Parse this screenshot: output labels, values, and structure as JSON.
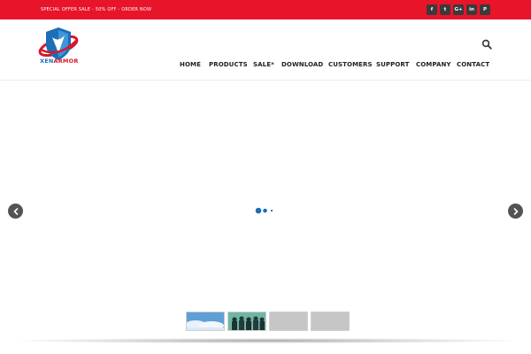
{
  "topbar": {
    "promo_text": "SPECIAL OFFER SALE - 50% OFF - ORDER NOW",
    "social": [
      {
        "label": "f",
        "icon": "facebook-icon"
      },
      {
        "label": "t",
        "icon": "twitter-icon"
      },
      {
        "label": "G+",
        "icon": "google-plus-icon"
      },
      {
        "label": "in",
        "icon": "linkedin-icon"
      },
      {
        "label": "P",
        "icon": "pinterest-icon"
      }
    ],
    "color": "#e8142a"
  },
  "brand": {
    "name_part1": "XEN",
    "name_part2": "ARMOR",
    "primary_color": "#1a6fb7",
    "accent_color": "#d8162a"
  },
  "nav": {
    "items": [
      {
        "label": "HOME"
      },
      {
        "label": "PRODUCTS"
      },
      {
        "label": "SALE*"
      },
      {
        "label": "DOWNLOAD"
      },
      {
        "label": "CUSTOMERS"
      },
      {
        "label": "SUPPORT"
      },
      {
        "label": "COMPANY"
      },
      {
        "label": "CONTACT"
      }
    ]
  },
  "slider": {
    "prev_icon": "chevron-left-icon",
    "next_icon": "chevron-right-icon",
    "loader_color": "#1a6fb7",
    "thumbnails": [
      {
        "icon": "sky-thumbnail"
      },
      {
        "icon": "team-thumbnail"
      },
      {
        "icon": "blank-thumbnail"
      },
      {
        "icon": "blank-thumbnail"
      }
    ]
  }
}
